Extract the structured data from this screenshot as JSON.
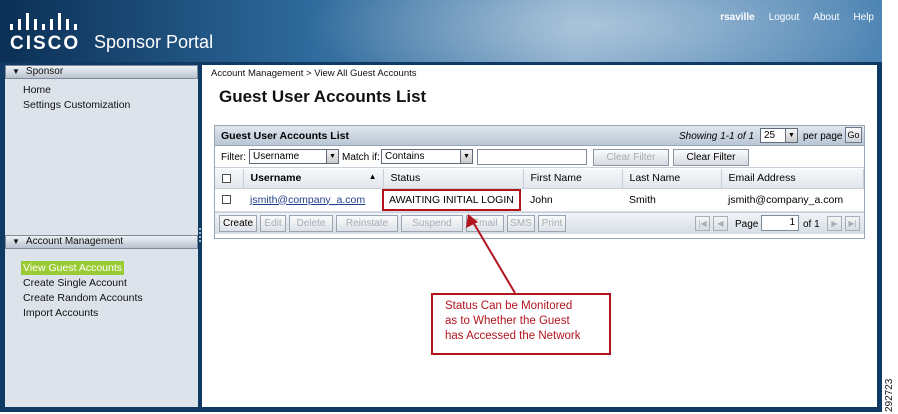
{
  "header": {
    "brand": "CISCO",
    "title": "Sponsor Portal",
    "user": "rsaville",
    "logout": "Logout",
    "about": "About",
    "help": "Help"
  },
  "sidebar": {
    "sponsor": {
      "title": "Sponsor",
      "items": [
        "Home",
        "Settings Customization"
      ]
    },
    "account_management": {
      "title": "Account Management",
      "items": [
        "View Guest Accounts",
        "Create Single Account",
        "Create Random Accounts",
        "Import Accounts"
      ],
      "active": "View Guest Accounts"
    }
  },
  "main": {
    "breadcrumb": "Account Management > View All Guest Accounts",
    "page_title": "Guest User Accounts List",
    "panel": {
      "title": "Guest User Accounts List",
      "showing": "Showing 1-1 of 1",
      "per_page_value": "25",
      "per_page_label": "per page",
      "go": "Go",
      "filter_label": "Filter:",
      "filter_value": "Username",
      "match_label": "Match if:",
      "match_value": "Contains",
      "filter_text": "",
      "clear_filter_disabled": "Clear Filter",
      "clear_filter": "Clear Filter",
      "columns": [
        "Username",
        "Status",
        "First Name",
        "Last Name",
        "Email Address"
      ],
      "sort_indicator": "▲",
      "rows": [
        {
          "username": "jsmith@company_a.com",
          "status": "AWAITING INITIAL LOGIN",
          "first_name": "John",
          "last_name": "Smith",
          "email": "jsmith@company_a.com"
        }
      ],
      "toolbar": {
        "create": "Create",
        "edit": "Edit",
        "delete": "Delete",
        "reinstate": "Reinstate",
        "suspend": "Suspend",
        "email": "Email",
        "sms": "SMS",
        "print": "Print",
        "page_label": "Page",
        "page_value": "1",
        "of_pages": "of 1"
      }
    }
  },
  "callout": {
    "line1": "Status Can be Monitored",
    "line2": "as to Whether the Guest",
    "line3": "has Accessed the Network"
  },
  "figure_id": "292723",
  "colors": {
    "header_dark": "#0b2f55",
    "active_nav": "#9acb34",
    "callout_red": "#b3151f"
  }
}
